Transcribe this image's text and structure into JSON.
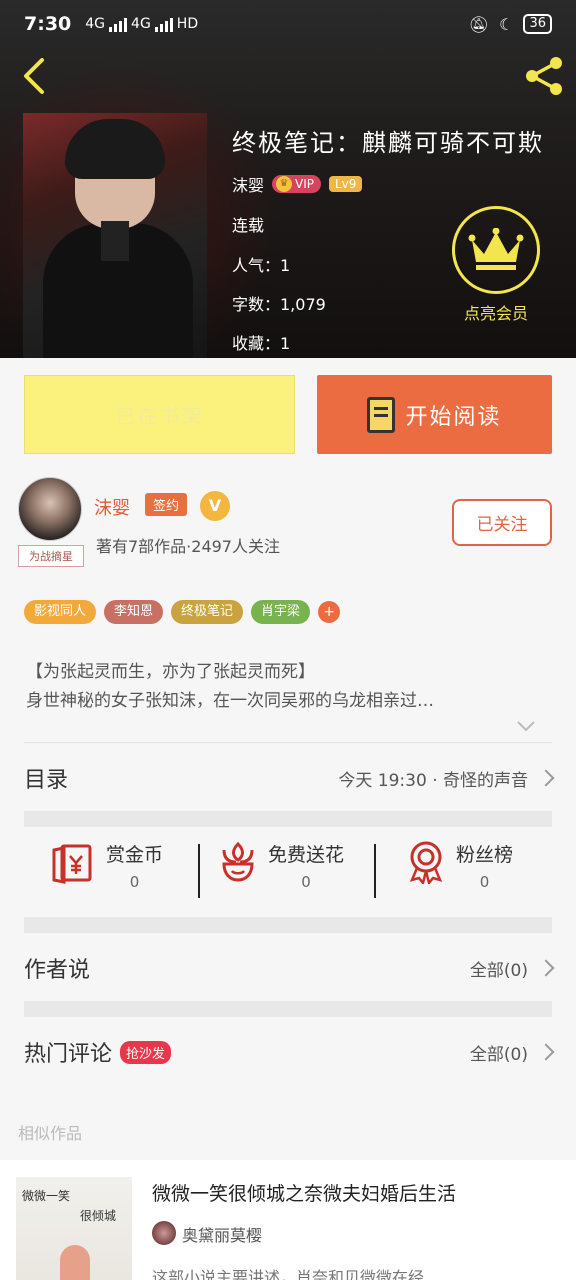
{
  "status_bar": {
    "time": "7:30",
    "net1": "4G",
    "net2": "4G",
    "hd": "HD",
    "battery": "36"
  },
  "book": {
    "title": "终极笔记：麒麟可骑不可欺",
    "author": "沫婴",
    "vip_label": "VIP",
    "level_label": "Lv9",
    "status": "连载",
    "popularity": "人气：1",
    "word_count": "字数：1,079",
    "favorites": "收藏：1"
  },
  "member": {
    "label": "点亮会员"
  },
  "actions": {
    "shelf_label": "已在书架",
    "read_label": "开始阅读"
  },
  "author": {
    "name": "沫婴",
    "signed_label": "签约",
    "v_label": "V",
    "stats": "著有7部作品·2497人关注",
    "follow_label": "已关注",
    "avatar_tag": "为战摘星"
  },
  "tags": [
    {
      "label": "影视同人",
      "color": "#f2a93b"
    },
    {
      "label": "李知恩",
      "color": "#c97064"
    },
    {
      "label": "终极笔记",
      "color": "#c9a33f"
    },
    {
      "label": "肖宇梁",
      "color": "#78b34f"
    }
  ],
  "tag_more": "+",
  "description": {
    "line1": "【为张起灵而生，亦为了张起灵而死】",
    "line2": "身世神秘的女子张知沫，在一次同吴邪的乌龙相亲过…"
  },
  "catalog": {
    "label": "目录",
    "latest": "今天 19:30 · 奇怪的声音"
  },
  "stats": {
    "reward_label": "赏金币",
    "reward_value": "0",
    "flower_label": "免费送花",
    "flower_value": "0",
    "fans_label": "粉丝榜",
    "fans_value": "0"
  },
  "author_says": {
    "label": "作者说",
    "all": "全部(0)"
  },
  "hot_comments": {
    "label": "热门评论",
    "badge": "抢沙发",
    "all": "全部(0)"
  },
  "similar": {
    "label": "相似作品",
    "title": "微微一笑很倾城之奈微夫妇婚后生活",
    "author": "奥黛丽莫樱",
    "desc": "这部小说主要讲述，肖奈和贝微微在经…",
    "cover_text1": "微微一笑",
    "cover_text2": "很倾城"
  },
  "colors": {
    "accent_orange": "#ec6c42",
    "accent_yellow": "#f3e64c",
    "shelf_yellow": "#fbf27e"
  }
}
